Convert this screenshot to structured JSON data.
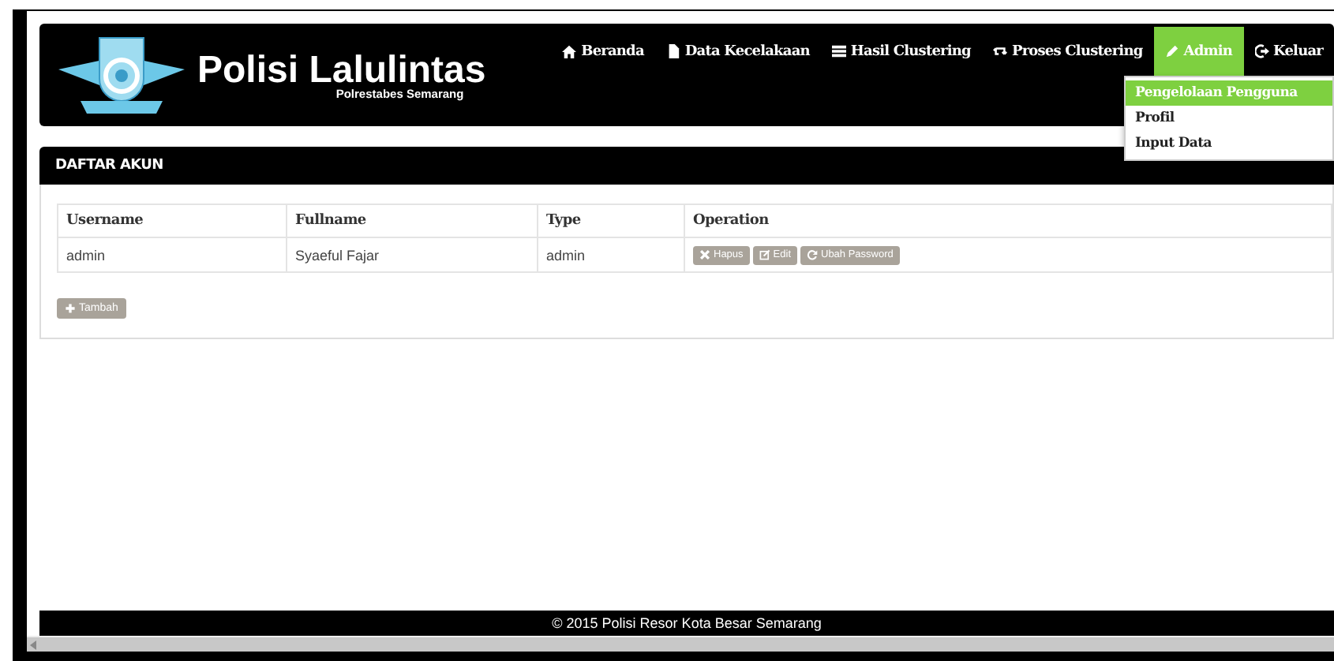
{
  "header": {
    "title": "Polisi Lalulintas",
    "subtitle": "Polrestabes Semarang"
  },
  "nav": [
    {
      "label": "Beranda",
      "kind": "home",
      "selected": false
    },
    {
      "label": "Data Kecelakaan",
      "kind": "file",
      "selected": false
    },
    {
      "label": "Hasil Clustering",
      "kind": "list",
      "selected": false
    },
    {
      "label": "Proses Clustering",
      "kind": "retweet",
      "selected": false
    },
    {
      "label": "Admin",
      "kind": "pencil",
      "selected": true
    },
    {
      "label": "Keluar",
      "kind": "logout",
      "selected": false
    }
  ],
  "dropdown": [
    {
      "label": "Pengelolaan Pengguna",
      "selected": true
    },
    {
      "label": "Profil",
      "selected": false
    },
    {
      "label": "Input Data",
      "selected": false
    }
  ],
  "panel": {
    "title": "DAFTAR AKUN",
    "columns": [
      "Username",
      "Fullname",
      "Type",
      "Operation"
    ],
    "rows": [
      {
        "username": "admin",
        "fullname": "Syaeful Fajar",
        "type": "admin",
        "operations": [
          {
            "label": "Hapus",
            "kind": "remove"
          },
          {
            "label": "Edit",
            "kind": "edit"
          },
          {
            "label": "Ubah Password",
            "kind": "refresh"
          }
        ]
      }
    ],
    "add_button": {
      "label": "Tambah",
      "kind": "plus"
    }
  },
  "footer": "© 2015 Polisi Resor Kota Besar Semarang"
}
